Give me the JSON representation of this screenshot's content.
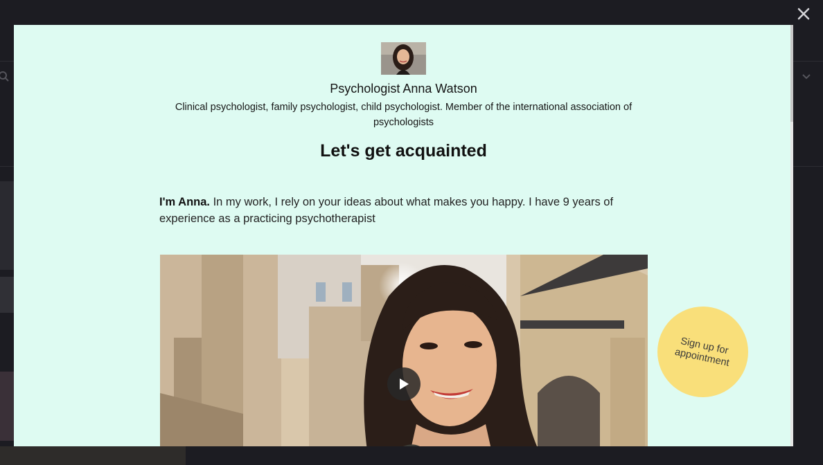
{
  "modal": {
    "close_icon": "close-icon",
    "profile": {
      "name": "Psychologist Anna Watson",
      "description": "Clinical psychologist, family psychologist, child psychologist. Member of the international association of psychologists"
    },
    "heading": "Let's get acquainted",
    "intro": {
      "lead": "I'm Anna.",
      "text": " In my work, I rely on your ideas about what makes you happy. I have 9 years of experience as a practicing psychotherapist"
    },
    "video": {
      "play_icon": "play-icon"
    },
    "signup_button": "Sign up for appointment"
  },
  "colors": {
    "modal_background": "#defbf2",
    "signup_background": "#f9df7a",
    "backdrop": "#1c1c22"
  }
}
